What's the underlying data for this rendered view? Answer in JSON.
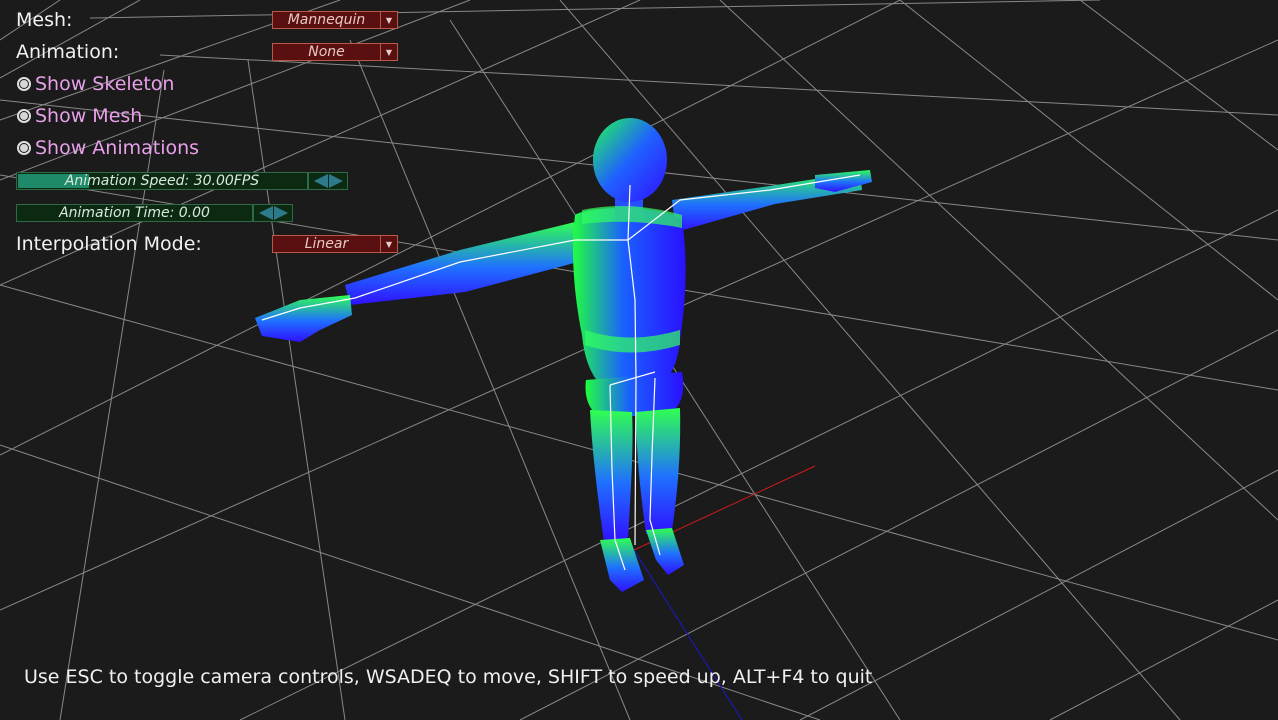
{
  "panel": {
    "mesh": {
      "label": "Mesh:",
      "value": "Mannequin"
    },
    "animation": {
      "label": "Animation:",
      "value": "None"
    },
    "show_skeleton": {
      "label": "Show Skeleton",
      "checked": true
    },
    "show_mesh": {
      "label": "Show Mesh",
      "checked": true
    },
    "show_animations": {
      "label": "Show Animations",
      "checked": true
    },
    "animation_speed": {
      "text": "Animation Speed: 30.00FPS",
      "fill_fraction": 0.25
    },
    "animation_time": {
      "text": "Animation Time: 0.00",
      "fill_fraction": 0.0
    },
    "interpolation_mode": {
      "label": "Interpolation Mode:",
      "value": "Linear"
    }
  },
  "hint": "Use ESC to toggle camera controls, WSADEQ to move, SHIFT to speed up, ALT+F4 to quit",
  "colors": {
    "background": "#1b1b1b",
    "grid": "#a8a8a8",
    "dropdown_bg": "#5a1010",
    "checkbox_label": "#e8a0ea",
    "slider_fill": "#1f8a6a",
    "axis_x": "#cc1a1a",
    "axis_z": "#1a1acc"
  }
}
